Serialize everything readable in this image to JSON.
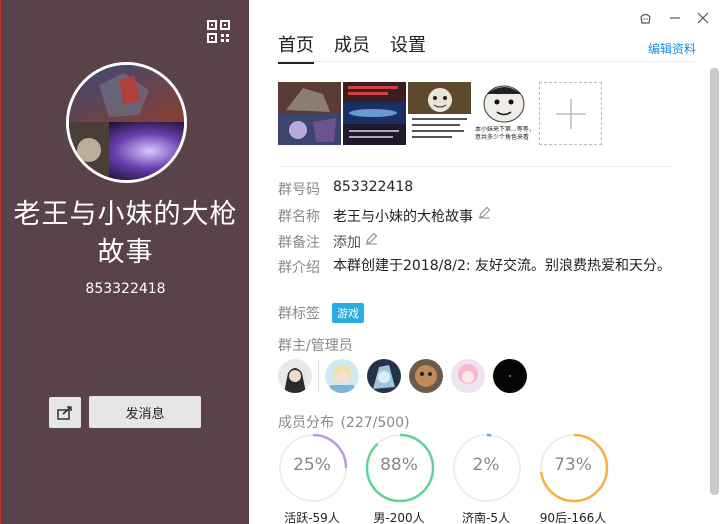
{
  "left": {
    "group_title": "老王与小妹的大枪故事",
    "group_id": "853322418",
    "message_button": "发消息"
  },
  "tabs": [
    {
      "label": "首页",
      "active": true
    },
    {
      "label": "成员",
      "active": false
    },
    {
      "label": "设置",
      "active": false
    }
  ],
  "edit_link": "编辑资料",
  "info": {
    "group_number_key": "群号码",
    "group_number_value": "853322418",
    "group_name_key": "群名称",
    "group_name_value": "老王与小妹的大枪故事",
    "remark_key": "群备注",
    "remark_value": "添加",
    "intro_key": "群介绍",
    "intro_value": "本群创建于2018/8/2: 友好交流。别浪费热爱和天分。",
    "tag_key": "群标签",
    "tag_value": "游戏"
  },
  "photo_texts": {
    "photo4": "本小妹来下第...等等，意共多少个角色来看"
  },
  "admins_label": "群主/管理员",
  "members": {
    "label": "成员分布",
    "count": "(227/500)"
  },
  "stats": [
    {
      "pct_label": "25%",
      "value": 25,
      "label": "活跃-59人",
      "color": "#b89ae0"
    },
    {
      "pct_label": "88%",
      "value": 88,
      "label": "男-200人",
      "color": "#5fd39a"
    },
    {
      "pct_label": "2%",
      "value": 2,
      "label": "济南-5人",
      "color": "#6aa8f0"
    },
    {
      "pct_label": "73%",
      "value": 73,
      "label": "90后-166人",
      "color": "#f5b040"
    }
  ],
  "colors": {
    "left_bg": "#594249",
    "link": "#1a8ee0",
    "tag_bg": "#2aace2"
  }
}
